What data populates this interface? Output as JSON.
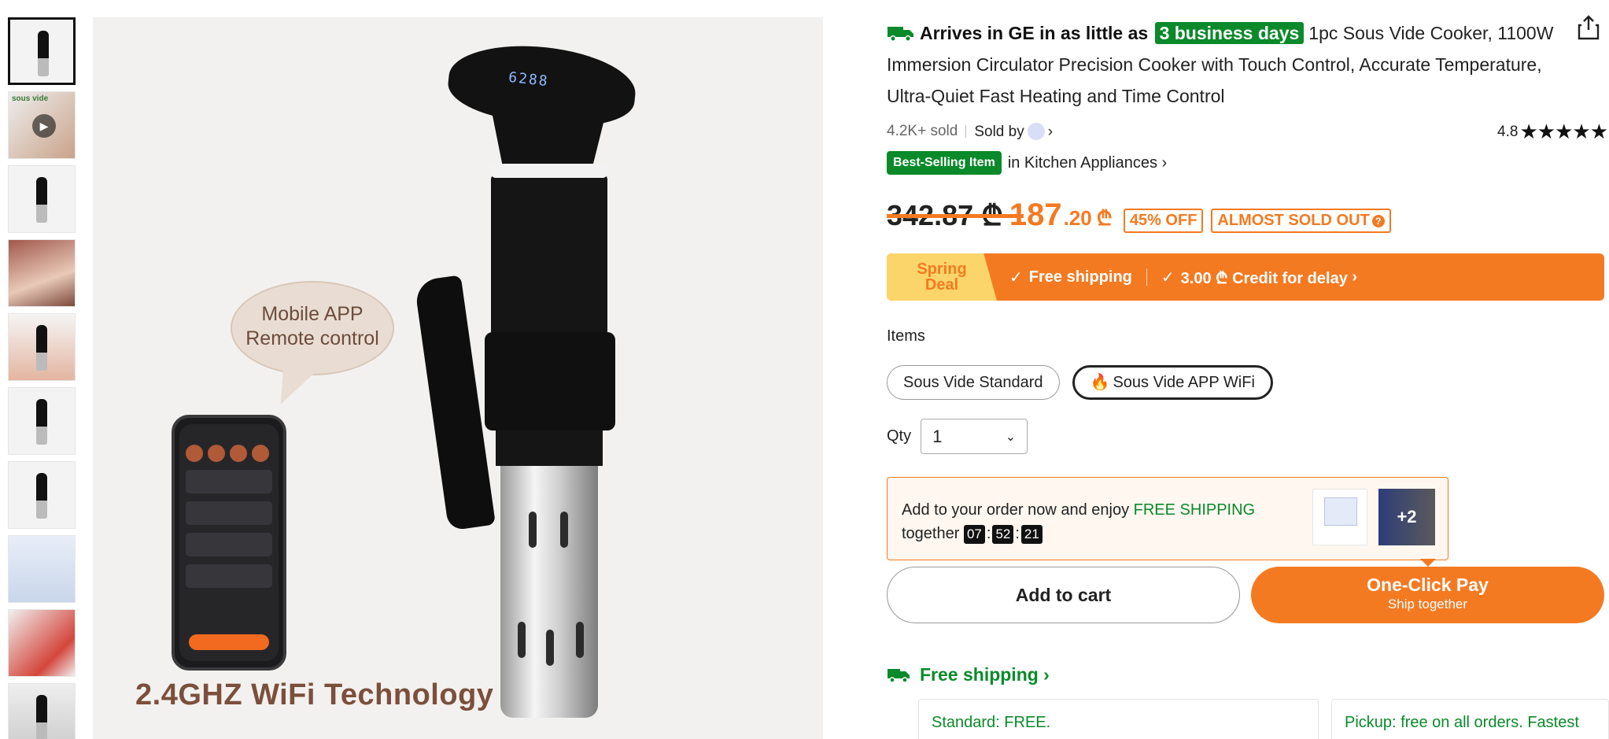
{
  "thumbnails": [
    {
      "name": "thumb-1"
    },
    {
      "name": "thumb-2",
      "label": "sous vide"
    },
    {
      "name": "thumb-3"
    },
    {
      "name": "thumb-4"
    },
    {
      "name": "thumb-5"
    },
    {
      "name": "thumb-6"
    },
    {
      "name": "thumb-7"
    },
    {
      "name": "thumb-8"
    },
    {
      "name": "thumb-9"
    },
    {
      "name": "thumb-10"
    }
  ],
  "main_image": {
    "bubble_line1": "Mobile APP",
    "bubble_line2": "Remote control",
    "caption": "2.4GHZ WiFi Technology",
    "device_display": "6288"
  },
  "product": {
    "arrive_prefix": "Arrives in GE in as little as",
    "arrive_badge": "3 business days",
    "title": "1pc Sous Vide Cooker, 1100W Immersion Circulator Precision Cooker with Touch Control, Accurate Temperature, Ultra-Quiet Fast Heating and Time Control",
    "sold_count": "4.2K+ sold",
    "sold_by": "Sold by",
    "rating": "4.8",
    "stars": "★★★★★",
    "best_badge": "Best-Selling Item",
    "best_category": "in Kitchen Appliances",
    "old_price": "342.87 ₾",
    "price_main": "187",
    "price_decimal": ".20",
    "currency": "₾",
    "discount_tag": "45% OFF",
    "stock_tag": "ALMOST SOLD OUT"
  },
  "deal_bar": {
    "label_line1": "Spring",
    "label_line2": "Deal",
    "item1": "Free shipping",
    "item2": "3.00 ₾ Credit for delay"
  },
  "items": {
    "label": "Items",
    "options": [
      "Sous Vide Standard",
      "Sous Vide APP WiFi"
    ],
    "selected": "Sous Vide APP WiFi"
  },
  "quantity": {
    "label": "Qty",
    "value": "1"
  },
  "promo": {
    "text_before": "Add to your order now and enjoy",
    "highlight": "FREE SHIPPING",
    "text_after": "together",
    "timer": [
      "07",
      "52",
      "21"
    ],
    "more_count": "+2"
  },
  "buttons": {
    "add_to_cart": "Add to cart",
    "one_click_pay": "One-Click Pay",
    "ship_together": "Ship together"
  },
  "shipping": {
    "heading": "Free shipping",
    "standard": "Standard: FREE.",
    "pickup": "Pickup: free on all orders. Fastest"
  },
  "colors": {
    "accent_orange": "#f47a22",
    "green": "#0a8a2a",
    "deal_yellow": "#fbd56a"
  }
}
